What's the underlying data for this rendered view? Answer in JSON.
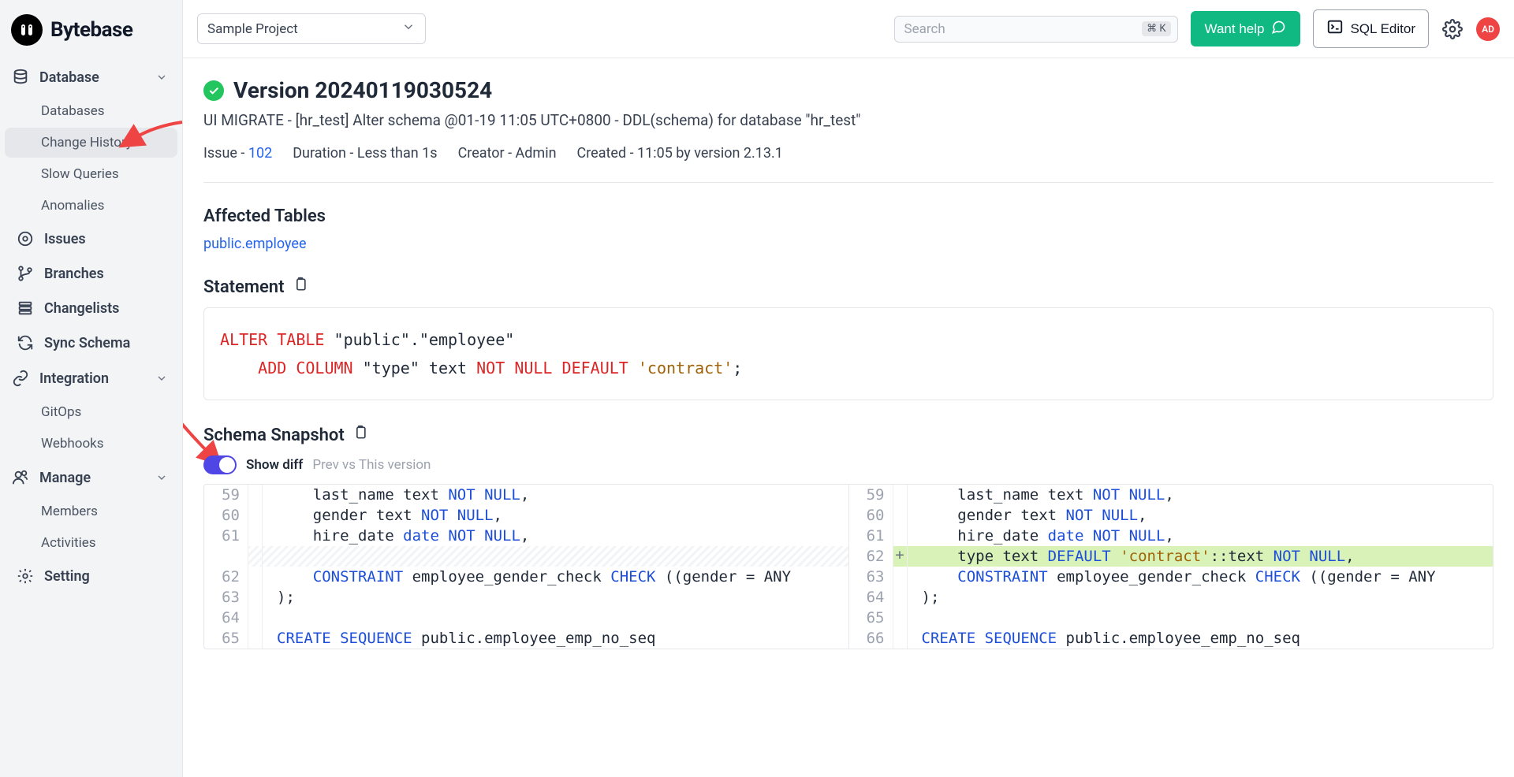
{
  "brand": "Bytebase",
  "project_selector": {
    "label": "Sample Project"
  },
  "search": {
    "placeholder": "Search",
    "kbd": "⌘ K"
  },
  "topbar": {
    "help_btn": "Want help",
    "sql_btn": "SQL Editor",
    "avatar": "AD"
  },
  "sidebar": {
    "database": {
      "label": "Database",
      "items": [
        "Databases",
        "Change History",
        "Slow Queries",
        "Anomalies"
      ]
    },
    "items": [
      {
        "label": "Issues"
      },
      {
        "label": "Branches"
      },
      {
        "label": "Changelists"
      },
      {
        "label": "Sync Schema"
      }
    ],
    "integration": {
      "label": "Integration",
      "items": [
        "GitOps",
        "Webhooks"
      ]
    },
    "manage": {
      "label": "Manage",
      "items": [
        "Members",
        "Activities"
      ]
    },
    "setting": "Setting"
  },
  "page": {
    "title": "Version 20240119030524",
    "subtitle": "UI MIGRATE - [hr_test] Alter schema @01-19 11:05 UTC+0800 - DDL(schema) for database \"hr_test\"",
    "meta": {
      "issue_lbl": "Issue - ",
      "issue_no": "102",
      "duration": "Duration - Less than 1s",
      "creator": "Creator - Admin",
      "created": "Created - 11:05 by version 2.13.1"
    },
    "affected": {
      "heading": "Affected Tables",
      "table": "public.employee"
    },
    "statement": {
      "heading": "Statement"
    },
    "snapshot": {
      "heading": "Schema Snapshot",
      "toggle_label": "Show diff",
      "toggle_sub": "Prev vs This version"
    }
  },
  "stmt": {
    "p1": "ALTER",
    "p2": "TABLE",
    "p3": " \"public\".\"employee\"",
    "p4": "ADD",
    "p5": "COLUMN",
    "p6": " \"type\" text ",
    "p7": "NOT",
    "p8": "NULL",
    "p9": "DEFAULT",
    "p10": " ",
    "p11": "'contract'",
    "p12": ";"
  },
  "diff": {
    "left": [
      {
        "n": "59",
        "code": [
          {
            "t": "    last_name text "
          },
          {
            "t": "NOT NULL",
            "c": "k-blue"
          },
          {
            "t": ","
          }
        ]
      },
      {
        "n": "60",
        "code": [
          {
            "t": "    gender text "
          },
          {
            "t": "NOT NULL",
            "c": "k-blue"
          },
          {
            "t": ","
          }
        ]
      },
      {
        "n": "61",
        "code": [
          {
            "t": "    hire_date "
          },
          {
            "t": "date",
            "c": "k-blue"
          },
          {
            "t": " "
          },
          {
            "t": "NOT NULL",
            "c": "k-blue"
          },
          {
            "t": ","
          }
        ]
      },
      {
        "n": "",
        "hatch": true,
        "code": [
          {
            "t": " "
          }
        ]
      },
      {
        "n": "62",
        "code": [
          {
            "t": "    "
          },
          {
            "t": "CONSTRAINT",
            "c": "k-blue"
          },
          {
            "t": " employee_gender_check "
          },
          {
            "t": "CHECK",
            "c": "k-blue"
          },
          {
            "t": " ((gender = ANY"
          }
        ]
      },
      {
        "n": "63",
        "code": [
          {
            "t": ");"
          }
        ]
      },
      {
        "n": "64",
        "code": [
          {
            "t": ""
          }
        ]
      },
      {
        "n": "65",
        "code": [
          {
            "t": ""
          },
          {
            "t": "CREATE SEQUENCE",
            "c": "k-blue"
          },
          {
            "t": " public.employee_emp_no_seq"
          }
        ]
      }
    ],
    "right": [
      {
        "n": "59",
        "code": [
          {
            "t": "    last_name text "
          },
          {
            "t": "NOT NULL",
            "c": "k-blue"
          },
          {
            "t": ","
          }
        ]
      },
      {
        "n": "60",
        "code": [
          {
            "t": "    gender text "
          },
          {
            "t": "NOT NULL",
            "c": "k-blue"
          },
          {
            "t": ","
          }
        ]
      },
      {
        "n": "61",
        "code": [
          {
            "t": "    hire_date "
          },
          {
            "t": "date",
            "c": "k-blue"
          },
          {
            "t": " "
          },
          {
            "t": "NOT NULL",
            "c": "k-blue"
          },
          {
            "t": ","
          }
        ]
      },
      {
        "n": "62",
        "sign": "+",
        "added": true,
        "code": [
          {
            "t": "    type text "
          },
          {
            "t": "DEFAULT",
            "c": "k-blue"
          },
          {
            "t": " "
          },
          {
            "t": "'contract'",
            "c": "k-brown"
          },
          {
            "t": "::text "
          },
          {
            "t": "NOT NULL",
            "c": "k-blue"
          },
          {
            "t": ","
          }
        ]
      },
      {
        "n": "63",
        "code": [
          {
            "t": "    "
          },
          {
            "t": "CONSTRAINT",
            "c": "k-blue"
          },
          {
            "t": " employee_gender_check "
          },
          {
            "t": "CHECK",
            "c": "k-blue"
          },
          {
            "t": " ((gender = ANY"
          }
        ]
      },
      {
        "n": "64",
        "code": [
          {
            "t": ");"
          }
        ]
      },
      {
        "n": "65",
        "code": [
          {
            "t": ""
          }
        ]
      },
      {
        "n": "66",
        "code": [
          {
            "t": ""
          },
          {
            "t": "CREATE SEQUENCE",
            "c": "k-blue"
          },
          {
            "t": " public.employee_emp_no_seq"
          }
        ]
      }
    ]
  }
}
